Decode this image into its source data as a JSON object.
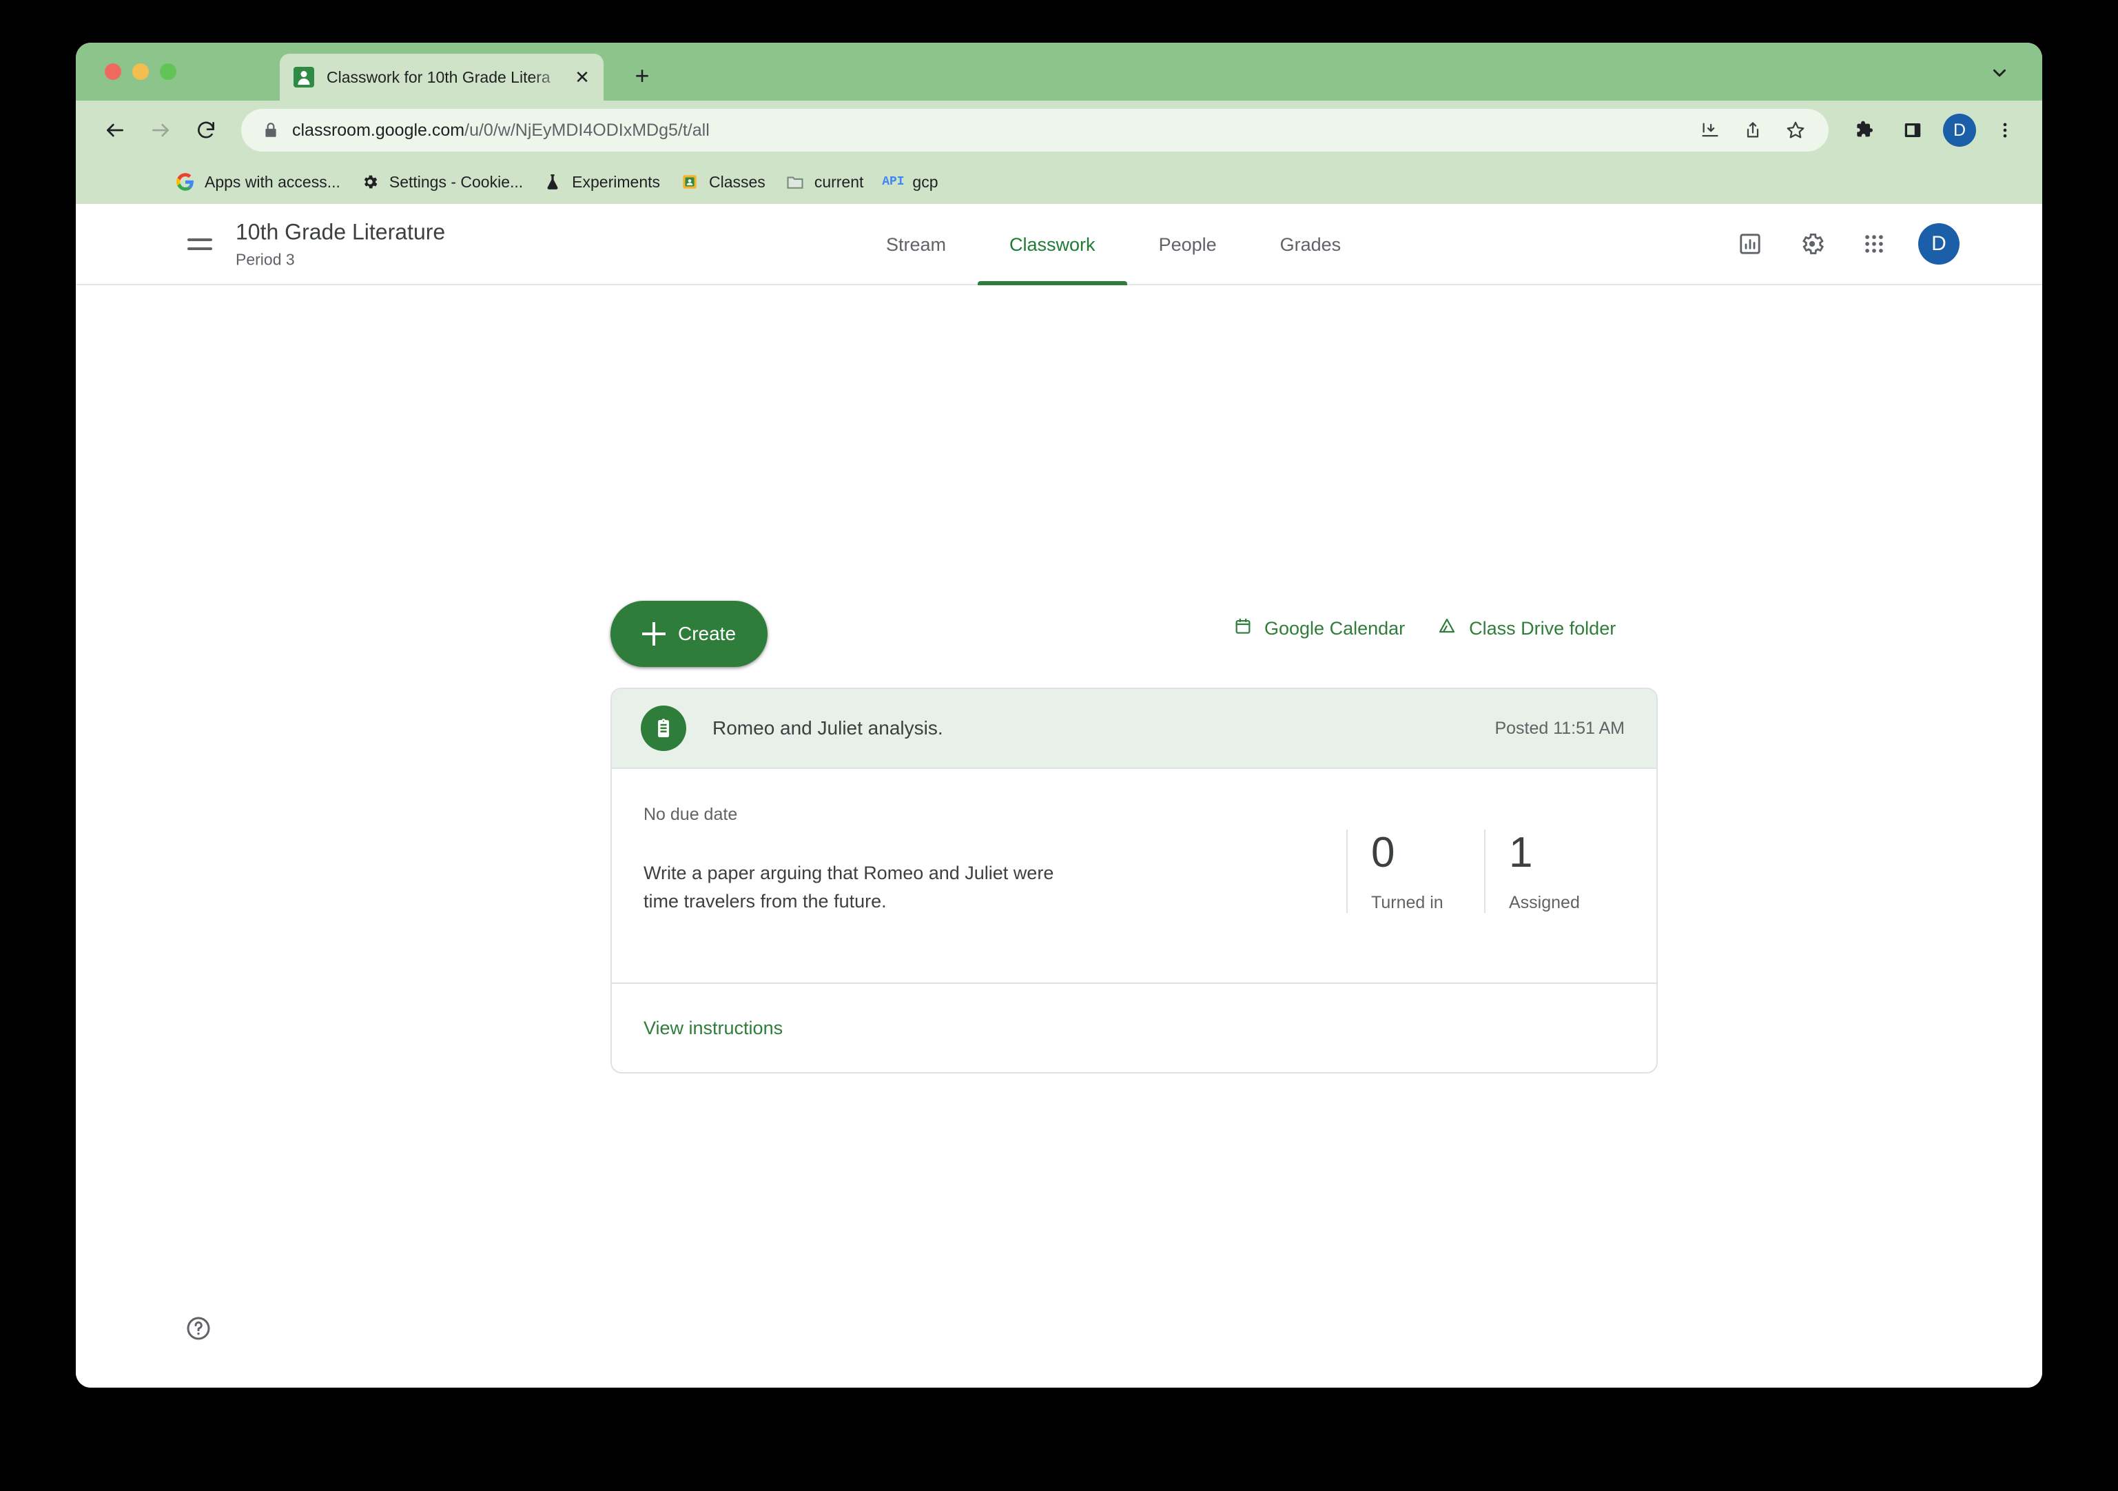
{
  "browser": {
    "tab": {
      "title": "Classwork for 10th Grade Litera",
      "favicon_icon": "google-classroom-favicon",
      "close_icon": "close-icon"
    },
    "new_tab_icon": "plus-icon",
    "tabstrip_chevron_icon": "chevron-down-icon",
    "toolbar": {
      "back_icon": "back-arrow-icon",
      "forward_icon": "forward-arrow-icon",
      "reload_icon": "reload-icon",
      "lock_icon": "lock-icon",
      "url_domain": "classroom.google.com",
      "url_path": "/u/0/w/NjEyMDI4ODIxMDg5/t/all",
      "install_icon": "install-app-icon",
      "share_icon": "share-icon",
      "bookmark_icon": "star-icon",
      "extensions_icon": "puzzle-piece-icon",
      "side_panel_icon": "side-panel-icon",
      "profile_initial": "D",
      "menu_icon": "three-dot-menu-icon"
    },
    "bookmarks": [
      {
        "label": "Apps with access...",
        "icon": "google-g-icon"
      },
      {
        "label": "Settings - Cookie...",
        "icon": "gear-icon"
      },
      {
        "label": "Experiments",
        "icon": "flask-icon"
      },
      {
        "label": "Classes",
        "icon": "google-classroom-icon"
      },
      {
        "label": "current",
        "icon": "folder-icon"
      },
      {
        "label": "gcp",
        "icon": "api-icon"
      }
    ]
  },
  "classroom": {
    "header": {
      "menu_icon": "hamburger-menu-icon",
      "class_title": "10th Grade Literature",
      "class_section": "Period 3",
      "tabs": [
        {
          "label": "Stream",
          "active": false
        },
        {
          "label": "Classwork",
          "active": true
        },
        {
          "label": "People",
          "active": false
        },
        {
          "label": "Grades",
          "active": false
        }
      ],
      "actions": {
        "insights_icon": "insights-chart-icon",
        "settings_icon": "gear-icon",
        "apps_icon": "apps-grid-icon",
        "avatar_initial": "D"
      }
    },
    "toolbar": {
      "create_label": "Create",
      "create_icon": "plus-icon",
      "links": [
        {
          "label": "Google Calendar",
          "icon": "calendar-icon"
        },
        {
          "label": "Class Drive folder",
          "icon": "drive-icon"
        }
      ]
    },
    "assignment": {
      "icon": "assignment-clipboard-icon",
      "title": "Romeo and Juliet analysis.",
      "posted": "Posted 11:51 AM",
      "due_date": "No due date",
      "description": "Write a paper arguing that Romeo and Juliet were time travelers from the future.",
      "stats": [
        {
          "value": "0",
          "label": "Turned in"
        },
        {
          "value": "1",
          "label": "Assigned"
        }
      ],
      "view_instructions_label": "View instructions"
    },
    "help_icon": "help-question-icon"
  },
  "colors": {
    "brand_green": "#2f7d3a",
    "chrome_green": "#8cc48c",
    "toolbar_green": "#cfe3c9",
    "card_header_green": "#e7f0e9",
    "avatar_blue": "#1a5fa8"
  }
}
